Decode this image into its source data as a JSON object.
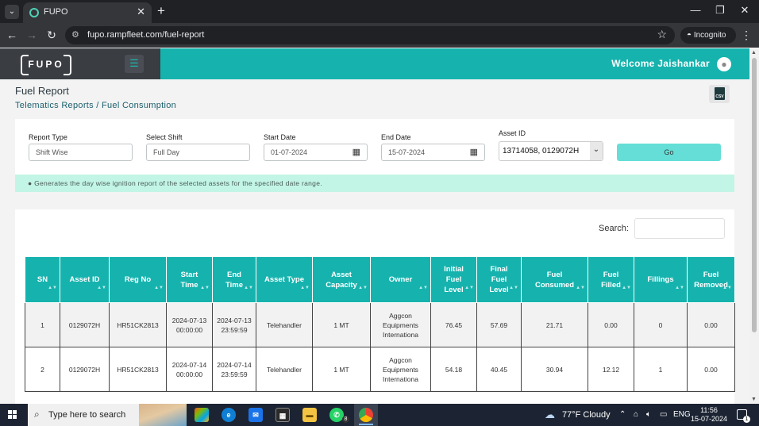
{
  "browser": {
    "tab_title": "FUPO",
    "url": "fupo.rampfleet.com/fuel-report",
    "incognito_label": "Incognito",
    "new_tab_glyph": "+",
    "close_glyph": "✕"
  },
  "header": {
    "logo_text": "FUPO",
    "welcome": "Welcome Jaishankar"
  },
  "page": {
    "title": "Fuel Report",
    "breadcrumb": "Telematics Reports  /  Fuel Consumption",
    "csv_label": "CSV"
  },
  "filters": {
    "report_type": {
      "label": "Report Type",
      "placeholder": "Shift Wise"
    },
    "shift": {
      "label": "Select Shift",
      "placeholder": "Full Day"
    },
    "start_date": {
      "label": "Start Date",
      "value": "01-07-2024"
    },
    "end_date": {
      "label": "End Date",
      "value": "15-07-2024"
    },
    "asset_id": {
      "label": "Asset ID",
      "value": "13714058, 0129072H"
    },
    "go_label": "Go",
    "info": "Generates the day wise ignition report of the selected assets for the specified date range."
  },
  "table": {
    "search_label": "Search:",
    "columns": [
      "SN",
      "Asset ID",
      "Reg No",
      "Start Time",
      "End Time",
      "Asset Type",
      "Asset Capacity",
      "Owner",
      "Initial Fuel Level",
      "Final Fuel Level",
      "Fuel Consumed",
      "Fuel Filled",
      "Fillings",
      "Fuel Removed"
    ],
    "rows": [
      {
        "sn": "1",
        "asset_id": "0129072H",
        "reg_no": "HR51CK2813",
        "start_time": "2024-07-13 00:00:00",
        "end_time": "2024-07-13 23:59:59",
        "asset_type": "Telehandler",
        "asset_capacity": "1 MT",
        "owner": "Aggcon Equipments Internationa",
        "initial_fuel": "76.45",
        "final_fuel": "57.69",
        "fuel_consumed": "21.71",
        "fuel_filled": "0.00",
        "fillings": "0",
        "fuel_removed": "0.00"
      },
      {
        "sn": "2",
        "asset_id": "0129072H",
        "reg_no": "HR51CK2813",
        "start_time": "2024-07-14 00:00:00",
        "end_time": "2024-07-14 23:59:59",
        "asset_type": "Telehandler",
        "asset_capacity": "1 MT",
        "owner": "Aggcon Equipments Internationa",
        "initial_fuel": "54.18",
        "final_fuel": "40.45",
        "fuel_consumed": "30.94",
        "fuel_filled": "12.12",
        "fillings": "1",
        "fuel_removed": "0.00"
      }
    ]
  },
  "taskbar": {
    "search_placeholder": "Type here to search",
    "weather": "77°F  Cloudy",
    "language": "ENG",
    "time": "11:56",
    "date": "15-07-2024",
    "whatsapp_badge": "8",
    "notification_count": "1"
  },
  "colors": {
    "accent": "#16b3ae",
    "go_button": "#64ded6",
    "info_bar": "#c2f5e6",
    "logo_bg": "#3a3d42"
  }
}
